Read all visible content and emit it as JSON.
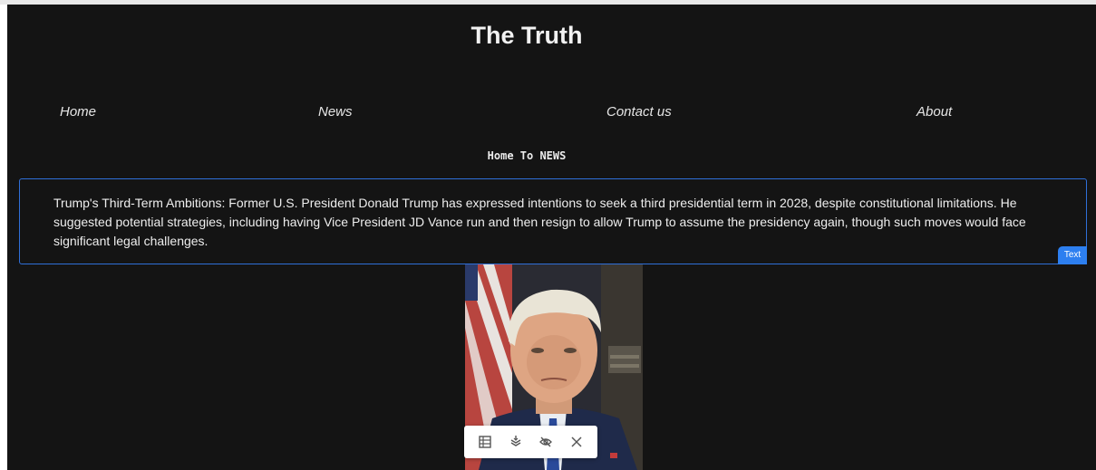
{
  "site": {
    "title": "The Truth"
  },
  "nav": {
    "home": "Home",
    "news": "News",
    "contact": "Contact us",
    "about": "About"
  },
  "section": {
    "heading": "Home To NEWS"
  },
  "article": {
    "text": "Trump's Third-Term Ambitions: Former U.S. President Donald Trump has expressed intentions to seek a third presidential term in 2028, despite constitutional limitations. He suggested potential strategies, including having Vice President JD Vance run and then resign to allow Trump to assume the presidency again, though such moves would face significant legal challenges.",
    "tag": "Text"
  },
  "toolbar": {
    "icons": [
      "table-icon",
      "layers-icon",
      "eye-off-icon",
      "close-icon"
    ]
  },
  "colors": {
    "background": "#141414",
    "accent": "#2d7ff0"
  }
}
